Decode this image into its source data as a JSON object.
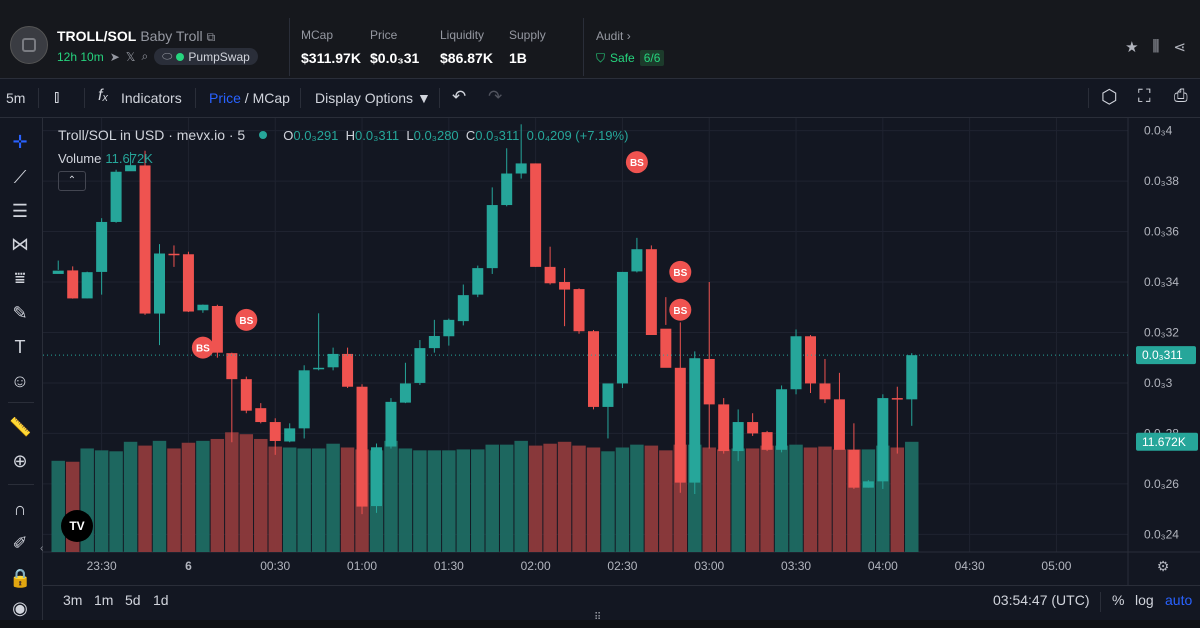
{
  "header": {
    "pair": "TROLL/SOL",
    "name": "Baby Troll",
    "age": "12h 10m",
    "dex": "PumpSwap",
    "stats": [
      {
        "label": "MCap",
        "value": "$311.97K"
      },
      {
        "label": "Price",
        "value": "$0.0₃31"
      },
      {
        "label": "Liquidity",
        "value": "$86.87K"
      },
      {
        "label": "Supply",
        "value": "1B"
      }
    ],
    "audit_label": "Audit",
    "safe_label": "Safe",
    "safe_count": "6/6"
  },
  "toolbar": {
    "interval": "5m",
    "indicators": "Indicators",
    "price": "Price",
    "slash": " / ",
    "mcap": "MCap",
    "display": "Display Options"
  },
  "legend": {
    "title": "Troll/SOL in USD · mevx.io · 5",
    "o_label": "O",
    "o_val": "0.0₃291",
    "h_label": "H",
    "h_val": "0.0₃311",
    "l_label": "L",
    "l_val": "0.0₃280",
    "c_label": "C",
    "c_val": "0.0₃311",
    "change": "0.0₄209 (+7.19%)",
    "volume_label": "Volume",
    "volume_val": "11.672K"
  },
  "bottom": {
    "ranges": [
      "3m",
      "1m",
      "5d",
      "1d"
    ],
    "time": "03:54:47 (UTC)",
    "pct": "%",
    "log": "log",
    "auto": "auto"
  },
  "chart_data": {
    "type": "candlestick",
    "y_unit": "USD",
    "y_ticks": [
      "0.0₃4",
      "0.0₃38",
      "0.0₃36",
      "0.0₃34",
      "0.0₃32",
      "0.0₃3",
      "0.0₃28",
      "0.0₃26",
      "0.0₃24"
    ],
    "y_tick_values": [
      0.4,
      0.38,
      0.36,
      0.34,
      0.32,
      0.3,
      0.28,
      0.26,
      0.24
    ],
    "ylim": [
      0.233,
      0.405
    ],
    "x_ticks": [
      "23:30",
      "6",
      "00:30",
      "01:00",
      "01:30",
      "02:00",
      "02:30",
      "03:00",
      "03:30",
      "04:00",
      "04:30",
      "05:00"
    ],
    "x_tick_index": [
      3,
      9,
      15,
      21,
      27,
      33,
      39,
      45,
      51,
      57,
      63,
      69
    ],
    "n_slots": 75,
    "last_price_label": "0.0₃311",
    "last_price": 0.311,
    "volume_label": "11.672K",
    "volume_max": 12,
    "candles": [
      [
        0.3432,
        0.3485,
        0.3448,
        0.3445
      ],
      [
        0.3446,
        0.3462,
        0.3334,
        0.3335
      ],
      [
        0.3335,
        0.3441,
        0.3335,
        0.3439
      ],
      [
        0.344,
        0.3653,
        0.335,
        0.3638
      ],
      [
        0.3638,
        0.3845,
        0.3635,
        0.3837
      ],
      [
        0.3839,
        0.3915,
        0.384,
        0.3863
      ],
      [
        0.3862,
        0.392,
        0.327,
        0.3275
      ],
      [
        0.3275,
        0.355,
        0.315,
        0.3513
      ],
      [
        0.3512,
        0.3545,
        0.346,
        0.351
      ],
      [
        0.351,
        0.352,
        0.3281,
        0.3283
      ],
      [
        0.3288,
        0.3311,
        0.3278,
        0.331
      ],
      [
        0.3305,
        0.331,
        0.31,
        0.312
      ],
      [
        0.3118,
        0.312,
        0.2765,
        0.3015
      ],
      [
        0.3015,
        0.3025,
        0.288,
        0.289
      ],
      [
        0.29,
        0.292,
        0.284,
        0.2845
      ],
      [
        0.2845,
        0.286,
        0.2715,
        0.277
      ],
      [
        0.2768,
        0.284,
        0.2765,
        0.282
      ],
      [
        0.282,
        0.307,
        0.278,
        0.305
      ],
      [
        0.3055,
        0.3276,
        0.305,
        0.306
      ],
      [
        0.3062,
        0.314,
        0.305,
        0.3115
      ],
      [
        0.3115,
        0.314,
        0.298,
        0.2985
      ],
      [
        0.2985,
        0.2995,
        0.248,
        0.251
      ],
      [
        0.2512,
        0.276,
        0.2485,
        0.2745
      ],
      [
        0.2748,
        0.294,
        0.274,
        0.2925
      ],
      [
        0.2922,
        0.308,
        0.292,
        0.2998
      ],
      [
        0.3,
        0.317,
        0.2992,
        0.3138
      ],
      [
        0.3138,
        0.325,
        0.312,
        0.3186
      ],
      [
        0.3185,
        0.3255,
        0.3148,
        0.325
      ],
      [
        0.3245,
        0.339,
        0.3228,
        0.3348
      ],
      [
        0.335,
        0.3465,
        0.334,
        0.3455
      ],
      [
        0.3455,
        0.3775,
        0.3432,
        0.3705
      ],
      [
        0.3705,
        0.393,
        0.37,
        0.383
      ],
      [
        0.383,
        0.4025,
        0.381,
        0.387
      ],
      [
        0.387,
        0.387,
        0.346,
        0.346
      ],
      [
        0.346,
        0.354,
        0.339,
        0.3395
      ],
      [
        0.34,
        0.3455,
        0.3225,
        0.337
      ],
      [
        0.3372,
        0.3375,
        0.3195,
        0.3205
      ],
      [
        0.3205,
        0.321,
        0.2895,
        0.2905
      ],
      [
        0.2905,
        0.2995,
        0.278,
        0.2998
      ],
      [
        0.2998,
        0.344,
        0.298,
        0.344
      ],
      [
        0.3442,
        0.3575,
        0.3438,
        0.353
      ],
      [
        0.353,
        0.3545,
        0.319,
        0.319
      ],
      [
        0.3215,
        0.334,
        0.323,
        0.306
      ],
      [
        0.306,
        0.324,
        0.2565,
        0.2605
      ],
      [
        0.2605,
        0.3125,
        0.256,
        0.3098
      ],
      [
        0.3095,
        0.34,
        0.274,
        0.2915
      ],
      [
        0.2915,
        0.294,
        0.272,
        0.273
      ],
      [
        0.273,
        0.2895,
        0.269,
        0.2845
      ],
      [
        0.2845,
        0.288,
        0.279,
        0.28
      ],
      [
        0.2805,
        0.281,
        0.273,
        0.2735
      ],
      [
        0.2735,
        0.299,
        0.2725,
        0.2975
      ],
      [
        0.2975,
        0.3212,
        0.2955,
        0.3185
      ],
      [
        0.3185,
        0.319,
        0.296,
        0.2998
      ],
      [
        0.2998,
        0.3095,
        0.292,
        0.2935
      ],
      [
        0.2935,
        0.304,
        0.276,
        0.2735
      ],
      [
        0.2735,
        0.284,
        0.258,
        0.2585
      ],
      [
        0.2585,
        0.2615,
        0.2585,
        0.261
      ],
      [
        0.261,
        0.2955,
        0.258,
        0.294
      ],
      [
        0.294,
        0.2985,
        0.272,
        0.2935
      ],
      [
        0.2935,
        0.3118,
        0.283,
        0.311
      ]
    ],
    "volumes": [
      9.6,
      9.5,
      10.9,
      10.7,
      10.6,
      11.6,
      11.2,
      11.7,
      10.9,
      11.5,
      11.7,
      11.9,
      12.6,
      12.4,
      11.9,
      11.1,
      11.0,
      10.9,
      10.9,
      11.4,
      11.0,
      10.8,
      10.7,
      11.7,
      10.9,
      10.7,
      10.7,
      10.7,
      10.8,
      10.8,
      11.3,
      11.3,
      11.7,
      11.2,
      11.4,
      11.6,
      11.2,
      11.0,
      10.6,
      11.0,
      11.3,
      11.2,
      10.7,
      11.3,
      11.3,
      11.0,
      10.8,
      10.9,
      10.9,
      11.2,
      11.2,
      11.3,
      11.0,
      11.1,
      10.8,
      10.8,
      10.8,
      11.2,
      11.0,
      11.6
    ],
    "markers": [
      {
        "label": "BS",
        "index": 10,
        "price": 0.314
      },
      {
        "label": "BS",
        "index": 13,
        "price": 0.325
      },
      {
        "label": "BS",
        "index": 40,
        "price": 0.3875
      },
      {
        "label": "BS",
        "index": 43,
        "price": 0.344
      },
      {
        "label": "BS",
        "index": 43,
        "price": 0.329
      }
    ]
  }
}
